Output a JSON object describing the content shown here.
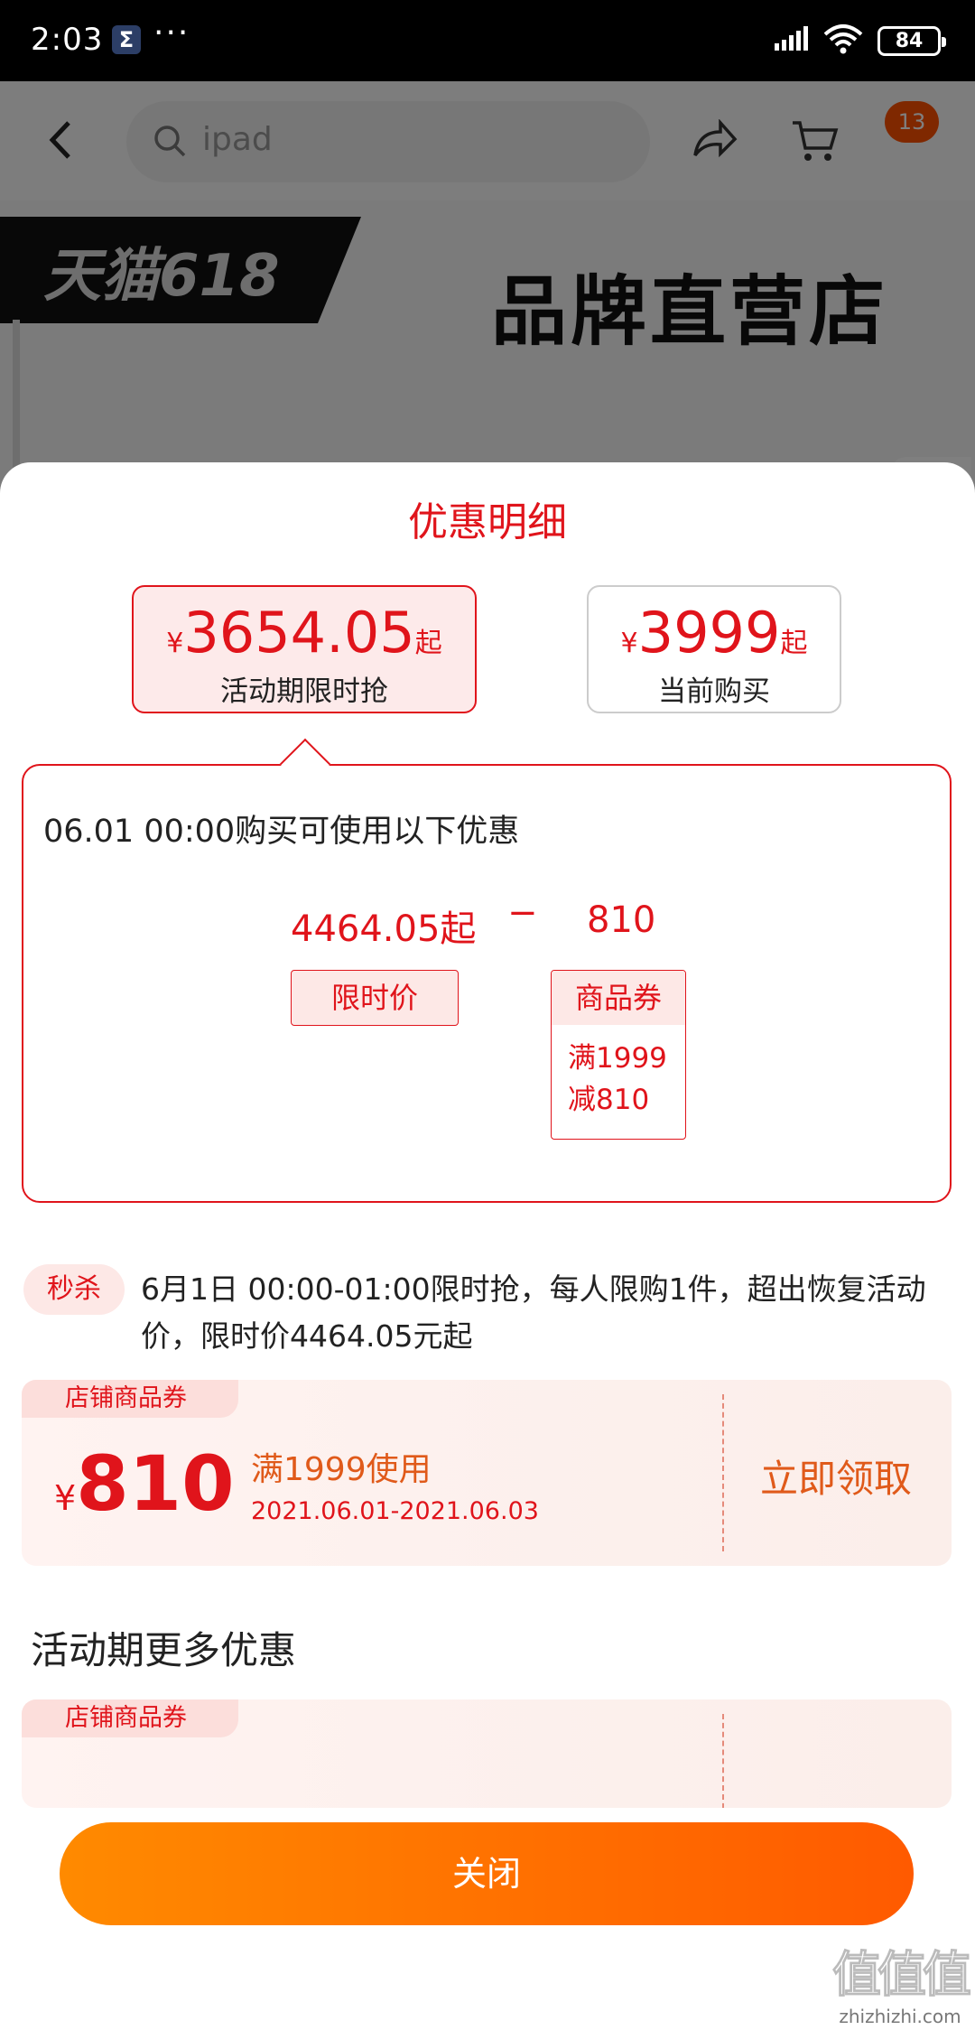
{
  "status_bar": {
    "time": "2:03",
    "notification_icon": "sigma-app-icon",
    "more_dots": "···",
    "battery": "84"
  },
  "background_page": {
    "search_placeholder": "ipad",
    "cart_count": "13",
    "banner_tmall": "天猫618",
    "banner_title": "品牌直营店"
  },
  "sheet": {
    "title": "优惠明细",
    "options": [
      {
        "currency": "¥",
        "price": "3654.05",
        "suffix": "起",
        "caption": "活动期限时抢",
        "selected": true
      },
      {
        "currency": "¥",
        "price": "3999",
        "suffix": "起",
        "caption": "当前购买",
        "selected": false
      }
    ],
    "detail": {
      "title": "06.01 00:00购买可使用以下优惠",
      "base_price": "4464.05起",
      "operator": "−",
      "discount": "810",
      "base_label": "限时价",
      "discount_label": "商品券",
      "discount_desc_line1": "满1999",
      "discount_desc_line2": "减810"
    },
    "seckill": {
      "badge": "秒杀",
      "text": "6月1日 00:00-01:00限时抢，每人限购1件，超出恢复活动价，限时价4464.05元起"
    },
    "coupon": {
      "tag": "店铺商品券",
      "currency": "¥",
      "amount": "810",
      "condition": "满1999使用",
      "date_range": "2021.06.01-2021.06.03",
      "claim": "立即领取"
    },
    "more_title": "活动期更多优惠",
    "coupon2_tag": "店铺商品券",
    "close_button": "关闭"
  },
  "watermark": {
    "logo": "值值值",
    "site": "zhizhizhi.com"
  },
  "colors": {
    "accent_red": "#e0141b",
    "orange_start": "#ff8a00",
    "orange_end": "#ff5a00"
  }
}
